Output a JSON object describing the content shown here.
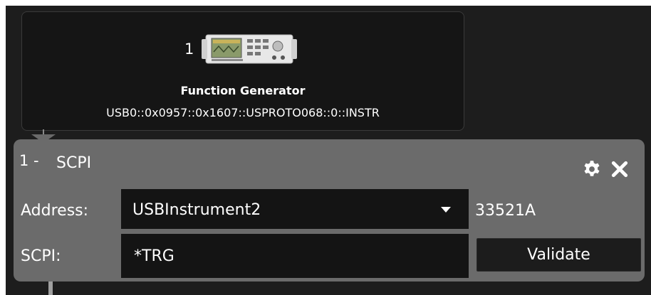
{
  "instrument": {
    "index": "1",
    "name": "Function Generator",
    "address": "USB0::0x0957::0x1607::USPROTO068::0::INSTR",
    "image_icon": "function-generator-device-icon"
  },
  "scpi_block": {
    "index": "1 -",
    "title": "SCPI",
    "settings_icon": "gear-icon",
    "close_icon": "close-icon",
    "address_label": "Address:",
    "address_value": "USBInstrument2",
    "model": "33521A",
    "scpi_label": "SCPI:",
    "scpi_value": "*TRG",
    "validate_label": "Validate"
  },
  "colors": {
    "canvas_bg": "#1d1d1d",
    "card_bg": "#151515",
    "block_bg": "#6b6b6b",
    "field_bg": "#141414",
    "text": "#ffffff"
  }
}
